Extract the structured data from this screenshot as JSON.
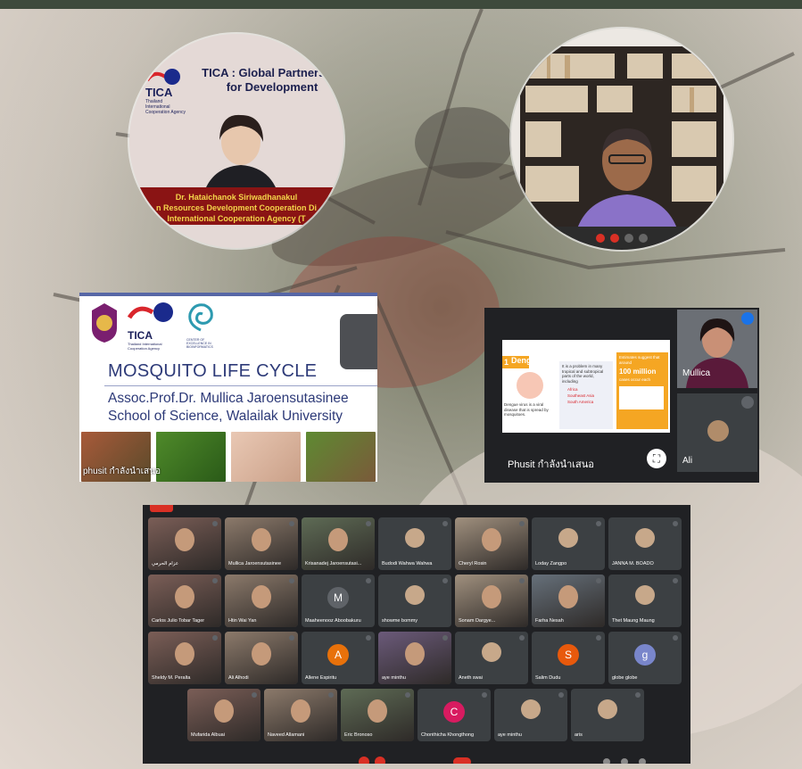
{
  "speakers": {
    "speaker1": {
      "org_short": "TICA",
      "org_full": "Thailand International Cooperation Agency",
      "banner": "TICA : Global Partnership for Development",
      "caption_line1": "Dr. Hataichanok  Siriwadhanakul",
      "caption_line2": "n Resources Development Cooperation Di",
      "caption_line3": "International Cooperation Agency (T"
    }
  },
  "slide": {
    "org_short": "TICA",
    "org_full": "Thailand International Cooperation Agency",
    "center_label": "CENTER OF EXCELLENCE IN BIOINFORMATICS",
    "title": "MOSQUITO LIFE CYCLE",
    "author": "Assoc.Prof.Dr. Mullica Jaroensutasinee",
    "school": "School of Science, Walailak University",
    "presenter_label": "phusit กำลังนำเสนอ"
  },
  "meet_small": {
    "slide_heading": "Dengue",
    "slide_number": "1",
    "col1_text": "Dengue virus is a viral disease that is spread by mosquitoes.",
    "col2_text": "It is a problem in many tropical and subtropical parts of the world, including",
    "col2_items": [
      "Africa",
      "Southeast Asia",
      "South America"
    ],
    "col3_text_top": "Estimates suggest that around",
    "col3_highlight": "100 million",
    "col3_text_bottom": "cases occur each",
    "presenting_label": "Phusit กำลังนำเสนอ",
    "tile1_name": "Mullica",
    "tile2_name": "Ali"
  },
  "participants": [
    {
      "name": "عزام الحرمي",
      "kind": "video"
    },
    {
      "name": "Mullica Jaroensutasinee",
      "kind": "video"
    },
    {
      "name": "Krisanadej Jaroensutasi...",
      "kind": "video"
    },
    {
      "name": "Budodi Wahwa Wahwa",
      "kind": "photo"
    },
    {
      "name": "Cheryl Rosin",
      "kind": "video"
    },
    {
      "name": "Loday Zangpo",
      "kind": "photo"
    },
    {
      "name": "JANNA M. BOADO",
      "kind": "photo"
    },
    {
      "name": "Carlos Julio Tobar Tager",
      "kind": "video"
    },
    {
      "name": "Htin Wai Yan",
      "kind": "video"
    },
    {
      "name": "Maaheenooz Aboobakuru",
      "kind": "letter",
      "letter": "M",
      "color": "#5f6368"
    },
    {
      "name": "showme bommy",
      "kind": "photo"
    },
    {
      "name": "Sonam Dargye...",
      "kind": "video"
    },
    {
      "name": "Farha Nesah",
      "kind": "video"
    },
    {
      "name": "Thet Maung Maung",
      "kind": "photo"
    },
    {
      "name": "Sheldy M. Peralta",
      "kind": "video"
    },
    {
      "name": "Ali Alhodi",
      "kind": "video"
    },
    {
      "name": "Allene Espiritu",
      "kind": "letter",
      "letter": "A",
      "color": "#e8710a"
    },
    {
      "name": "aye minthu",
      "kind": "video"
    },
    {
      "name": "Aneth swai",
      "kind": "photo"
    },
    {
      "name": "Salim Dudu",
      "kind": "letter",
      "letter": "S",
      "color": "#e8590c"
    },
    {
      "name": "globe globe",
      "kind": "letter",
      "letter": "g",
      "color": "#7986cb"
    },
    {
      "name": "Mufarida Albuai",
      "kind": "video"
    },
    {
      "name": "Naveed Allamani",
      "kind": "video"
    },
    {
      "name": "Eric Bronoso",
      "kind": "video"
    },
    {
      "name": "Chonthicha Khongthong",
      "kind": "letter",
      "letter": "C",
      "color": "#d81b60"
    },
    {
      "name": "aye minthu",
      "kind": "photo"
    },
    {
      "name": "aris",
      "kind": "photo"
    }
  ],
  "colors": {
    "meet_bg": "#202124",
    "tile_bg": "#3c4043",
    "tica_navy": "#1a1f5a",
    "slide_text": "#2d3a78",
    "end_call_red": "#d93025"
  }
}
